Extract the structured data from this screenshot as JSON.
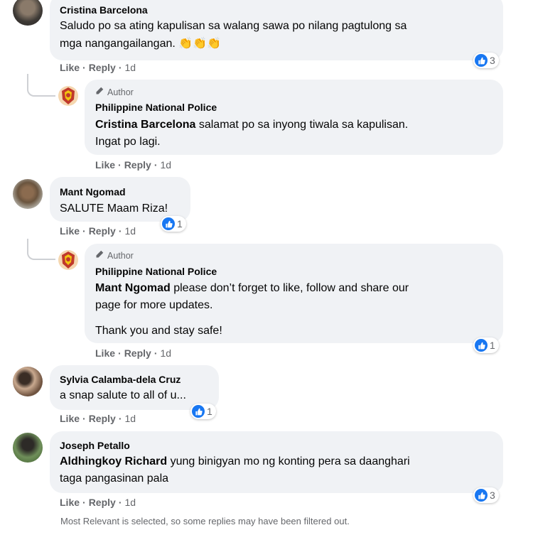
{
  "comments": [
    {
      "name": "Cristina Barcelona",
      "text_line1": "Saludo po sa ating kapulisan sa walang sawa po nilang pagtulong sa",
      "text_line2": "mga nangangailangan.",
      "emoji": "👏👏👏",
      "like": "Like",
      "reply": "Reply",
      "time": "1d",
      "reactions": "3"
    },
    {
      "name": "Mant Ngomad",
      "text": "SALUTE Maam Riza!",
      "like": "Like",
      "reply": "Reply",
      "time": "1d",
      "reactions": "1"
    },
    {
      "name": "Sylvia Calamba-dela Cruz",
      "text": "a snap salute to all of u...",
      "like": "Like",
      "reply": "Reply",
      "time": "1d",
      "reactions": "1"
    },
    {
      "name": "Joseph Petallo",
      "mention": "Aldhingkoy Richard",
      "text_line1": " yung binigyan mo ng konting pera sa daanghari",
      "text_line2": "taga pangasinan pala",
      "like": "Like",
      "reply": "Reply",
      "time": "1d",
      "reactions": "3"
    }
  ],
  "replies": [
    {
      "badge": "Author",
      "name": "Philippine National Police",
      "mention": "Cristina Barcelona",
      "text_line1": " salamat po sa inyong tiwala sa kapulisan.",
      "text_line2": "Ingat po lagi.",
      "like": "Like",
      "reply": "Reply",
      "time": "1d"
    },
    {
      "badge": "Author",
      "name": "Philippine National Police",
      "mention": "Mant Ngomad",
      "text_line1": " please don’t forget to like, follow and share our",
      "text_line2": "page for more updates.",
      "text_line3": "Thank you and stay safe!",
      "like": "Like",
      "reply": "Reply",
      "time": "1d",
      "reactions": "1"
    }
  ],
  "footer_note": "Most Relevant is selected, so some replies may have been filtered out.",
  "colors": {
    "like_blue": "#1877f2",
    "bubble": "#f0f2f5",
    "meta_gray": "#65676b"
  }
}
